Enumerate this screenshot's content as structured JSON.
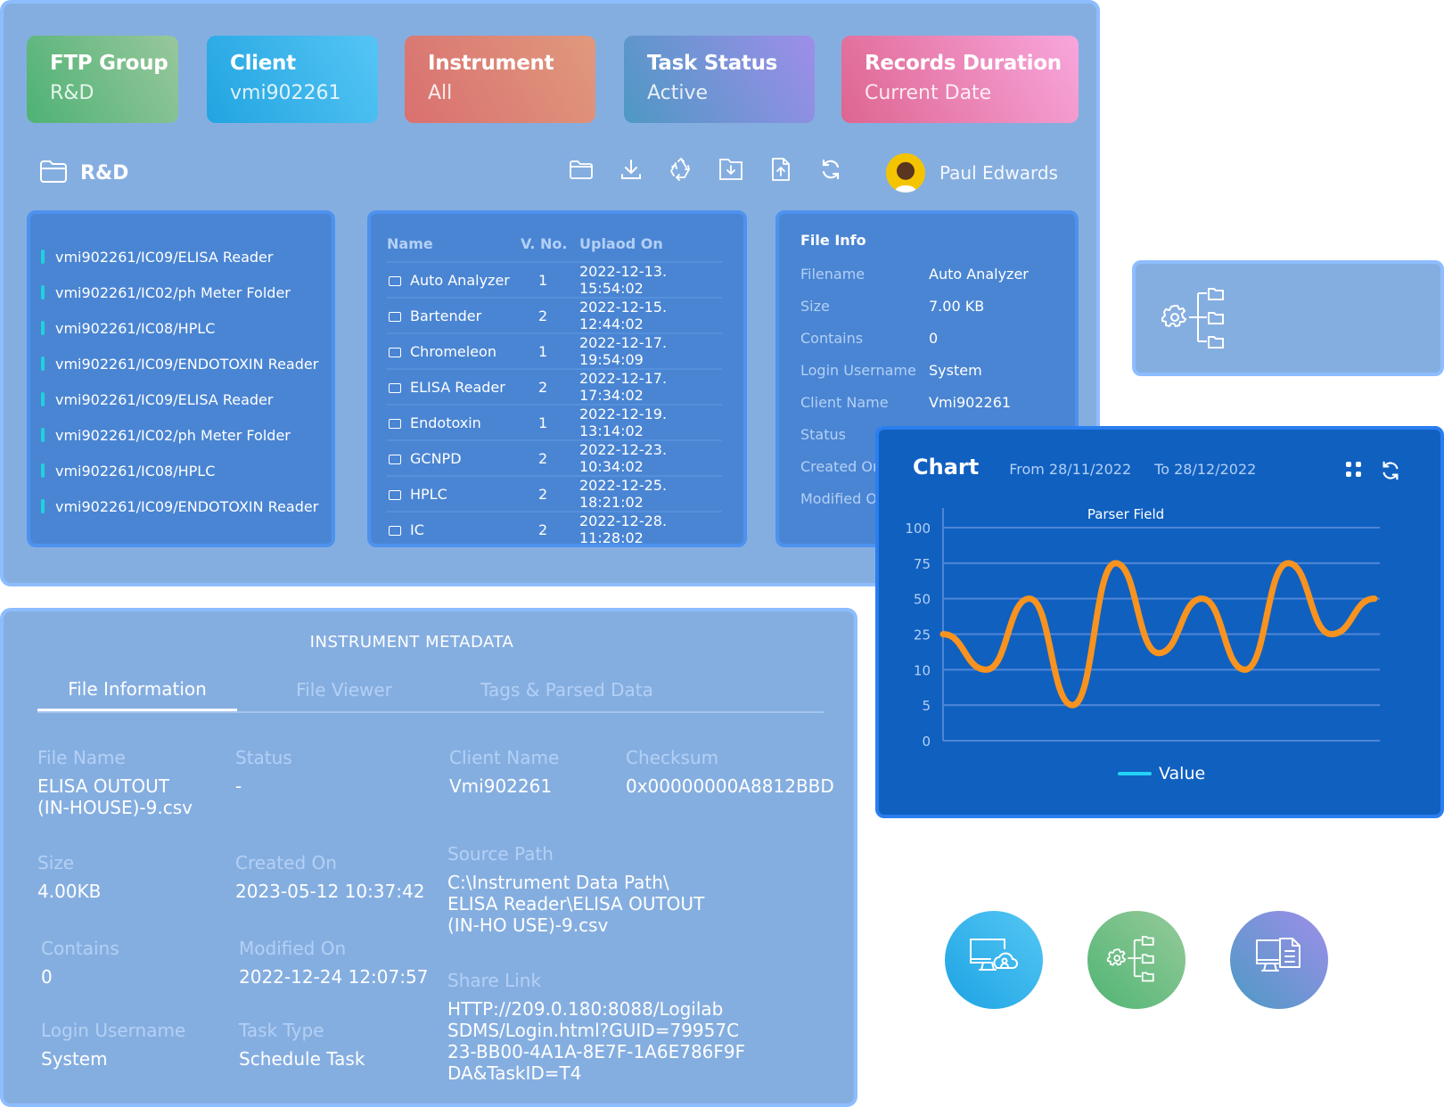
{
  "cards": [
    {
      "title": "FTP Group",
      "value": "R&D"
    },
    {
      "title": "Client",
      "value": "vmi902261"
    },
    {
      "title": "Instrument",
      "value": "All"
    },
    {
      "title": "Task Status",
      "value": "Active"
    },
    {
      "title": "Records Duration",
      "value": "Current Date"
    }
  ],
  "path": {
    "label": "R&D",
    "icon": "folder-icon"
  },
  "toolbar": {
    "icons": [
      "folder-icon",
      "download-icon",
      "recycle-icon",
      "folder-download-icon",
      "file-upload-icon",
      "refresh-icon"
    ]
  },
  "user": {
    "name": "Paul Edwards"
  },
  "tree": {
    "items": [
      "vmi902261/IC09/ELISA Reader",
      "vmi902261/IC02/ph Meter Folder",
      "vmi902261/IC08/HPLC",
      "vmi902261/IC09/ENDOTOXIN Reader",
      "vmi902261/IC09/ELISA Reader",
      "vmi902261/IC02/ph Meter Folder",
      "vmi902261/IC08/HPLC",
      "vmi902261/IC09/ENDOTOXIN Reader"
    ]
  },
  "files": {
    "columns": [
      "Name",
      "V. No.",
      "Uplaod On"
    ],
    "rows": [
      {
        "name": "Auto Analyzer",
        "vno": "1",
        "uploaded": "2022-12-13. 15:54:02"
      },
      {
        "name": "Bartender",
        "vno": "2",
        "uploaded": "2022-12-15. 12:44:02"
      },
      {
        "name": "Chromeleon",
        "vno": "1",
        "uploaded": "2022-12-17. 19:54:09"
      },
      {
        "name": "ELISA Reader",
        "vno": "2",
        "uploaded": "2022-12-17. 17:34:02"
      },
      {
        "name": "Endotoxin",
        "vno": "1",
        "uploaded": "2022-12-19. 13:14:02"
      },
      {
        "name": "GCNPD",
        "vno": "2",
        "uploaded": "2022-12-23. 10:34:02"
      },
      {
        "name": "HPLC",
        "vno": "2",
        "uploaded": "2022-12-25. 18:21:02"
      },
      {
        "name": "IC",
        "vno": "2",
        "uploaded": "2022-12-28. 11:28:02"
      }
    ]
  },
  "file_info": {
    "title": "File Info",
    "rows": [
      {
        "k": "Filename",
        "v": "Auto Analyzer"
      },
      {
        "k": "Size",
        "v": "7.00 KB"
      },
      {
        "k": "Contains",
        "v": "0"
      },
      {
        "k": "Login Username",
        "v": "System"
      },
      {
        "k": "Client Name",
        "v": "Vmi902261"
      },
      {
        "k": "Status",
        "v": ""
      },
      {
        "k": "Created On",
        "v": ""
      },
      {
        "k": "Modified On",
        "v": ""
      }
    ]
  },
  "metadata": {
    "title": "INSTRUMENT METADATA",
    "tabs": [
      "File Information",
      "File Viewer",
      "Tags & Parsed Data"
    ],
    "fields": {
      "file_name": {
        "k": "File Name",
        "v": "ELISA OUTOUT\n(IN-HOUSE)-9.csv"
      },
      "status": {
        "k": "Status",
        "v": "-"
      },
      "client_name": {
        "k": "Client Name",
        "v": "Vmi902261"
      },
      "checksum": {
        "k": "Checksum",
        "v": "0x00000000A8812BBD"
      },
      "size": {
        "k": "Size",
        "v": "4.00KB"
      },
      "created_on": {
        "k": "Created On",
        "v": "2023-05-12 10:37:42"
      },
      "source_path": {
        "k": "Source Path",
        "v": "C:\\Instrument Data Path\\\nELISA Reader\\ELISA OUTOUT\n(IN-HO USE)-9.csv"
      },
      "contains": {
        "k": "Contains",
        "v": "0"
      },
      "modified_on": {
        "k": "Modified On",
        "v": "2022-12-24 12:07:57"
      },
      "share_link": {
        "k": "Share Link",
        "v": "HTTP://209.0.180:8088/Logilab\nSDMS/Login.html?GUID=79957C\n23-BB00-4A1A-8E7F-1A6E786F9F\nDA&TaskID=T4"
      },
      "login_username": {
        "k": "Login Username",
        "v": "System"
      },
      "task_type": {
        "k": "Task Type",
        "v": "Schedule Task"
      }
    }
  },
  "chart_panel": {
    "title": "Chart",
    "from": "From 28/11/2022",
    "to": "To 28/12/2022"
  },
  "chart_data": {
    "type": "line",
    "title": "Parser Field",
    "xlabel": "",
    "ylabel": "",
    "y_ticks": [
      0,
      5,
      10,
      25,
      50,
      75,
      100
    ],
    "y_scale": "categorical-equal-spacing",
    "ylim": [
      0,
      100
    ],
    "grid": true,
    "legend": "bottom",
    "series": [
      {
        "name": "Value",
        "color": "#f7931e",
        "legend_color": "#22d3f5",
        "x": [
          0,
          1,
          2,
          3,
          4,
          5,
          6,
          7,
          8,
          9,
          10
        ],
        "values": [
          25,
          10,
          50,
          5,
          75,
          17,
          50,
          10,
          75,
          25,
          50
        ]
      }
    ]
  },
  "side_tile": {
    "icon": "gear-folder-tree-icon"
  },
  "feature_circles": [
    {
      "icon": "monitor-cloud-user-icon",
      "color_from": "#1da3e4",
      "color_to": "#55c7f4"
    },
    {
      "icon": "gear-folder-tree-icon",
      "color_from": "#50b574",
      "color_to": "#96ca9a"
    },
    {
      "icon": "monitor-document-icon",
      "color_from": "#4d9ac4",
      "color_to": "#9e8ee9"
    }
  ]
}
